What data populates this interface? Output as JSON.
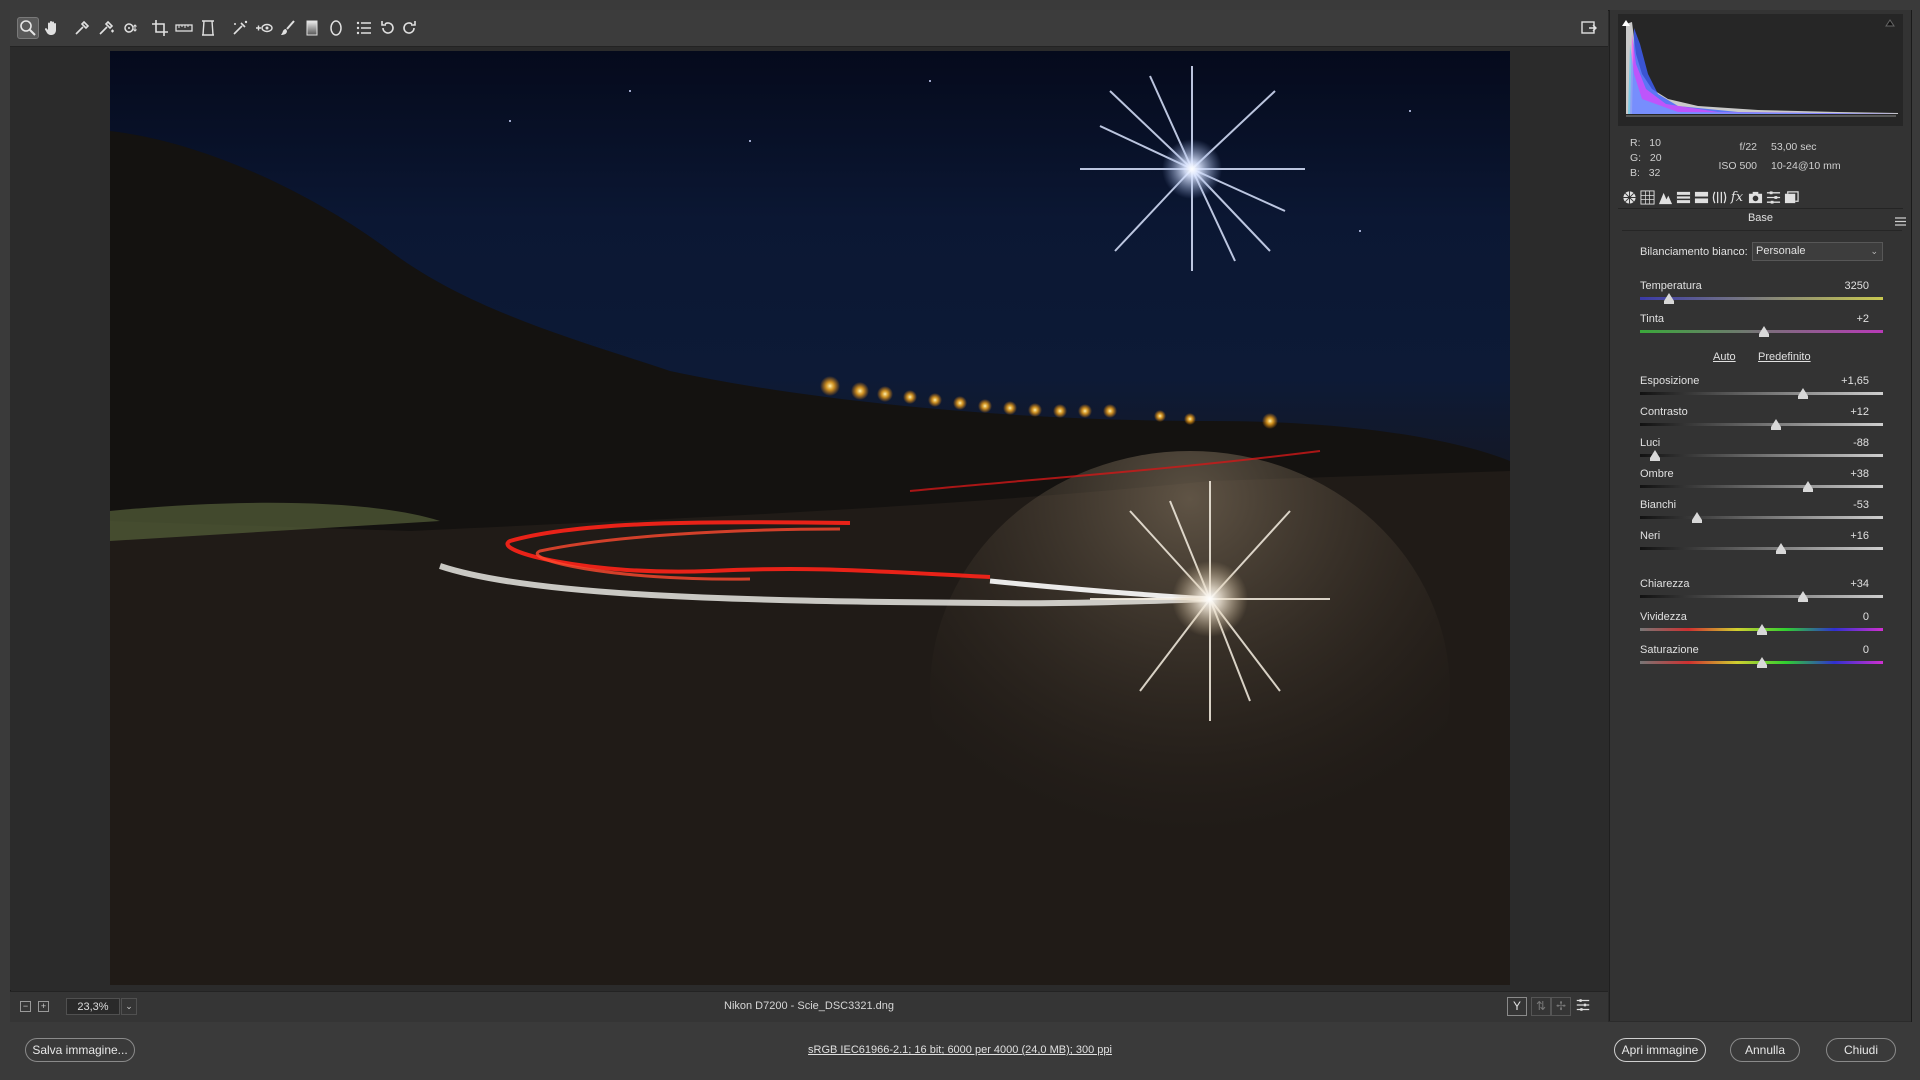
{
  "toolbar": {
    "tools": [
      "zoom-tool",
      "hand-tool",
      "white-balance-tool",
      "color-sampler-tool",
      "targeted-adjustment-tool",
      "crop-tool",
      "straighten-tool",
      "transform-tool",
      "spot-removal-tool",
      "red-eye-tool",
      "adjustment-brush-tool",
      "graduated-filter-tool",
      "radial-filter-tool",
      "preferences-tool",
      "rotate-ccw-tool",
      "rotate-cw-tool"
    ],
    "fullscreen_icon": "toggle-fullscreen-icon"
  },
  "histogram": {
    "r_label": "R:",
    "r": "10",
    "g_label": "G:",
    "g": "20",
    "b_label": "B:",
    "b": "32",
    "aperture": "f/22",
    "shutter": "53,00 sec",
    "iso": "ISO 500",
    "lens": "10-24@10 mm"
  },
  "panel": {
    "section_title": "Base",
    "wb_label": "Bilanciamento bianco:",
    "wb_value": "Personale",
    "auto": "Auto",
    "default": "Predefinito",
    "sliders": [
      {
        "label": "Temperatura",
        "value": "3250",
        "pos": 0.12
      },
      {
        "label": "Tinta",
        "value": "+2",
        "pos": 0.51
      },
      {
        "label": "Esposizione",
        "value": "+1,65",
        "pos": 0.67
      },
      {
        "label": "Contrasto",
        "value": "+12",
        "pos": 0.56
      },
      {
        "label": "Luci",
        "value": "-88",
        "pos": 0.06
      },
      {
        "label": "Ombre",
        "value": "+38",
        "pos": 0.69
      },
      {
        "label": "Bianchi",
        "value": "-53",
        "pos": 0.235
      },
      {
        "label": "Neri",
        "value": "+16",
        "pos": 0.58
      },
      {
        "label": "Chiarezza",
        "value": "+34",
        "pos": 0.67
      },
      {
        "label": "Vividezza",
        "value": "0",
        "pos": 0.5
      },
      {
        "label": "Saturazione",
        "value": "0",
        "pos": 0.5
      }
    ]
  },
  "status": {
    "zoom": "23,3%",
    "filename": "Nikon D7200  -  Scie_DSC3321.dng",
    "view_y": "Y"
  },
  "footer": {
    "save": "Salva immagine...",
    "workflow": "sRGB IEC61966-2.1; 16 bit; 6000 per 4000 (24,0 MB); 300 ppi",
    "open": "Apri immagine",
    "cancel": "Annulla",
    "close": "Chiudi"
  },
  "colors": {
    "temp_track": "linear-gradient(90deg,#3a3aa8,#c8c850)",
    "tint_track": "linear-gradient(90deg,#3aa83a,#b83ab8)",
    "vib_track": "linear-gradient(90deg,#777,#d03030,#d0d030,#30d030,#3030d0,#d030d0)"
  }
}
